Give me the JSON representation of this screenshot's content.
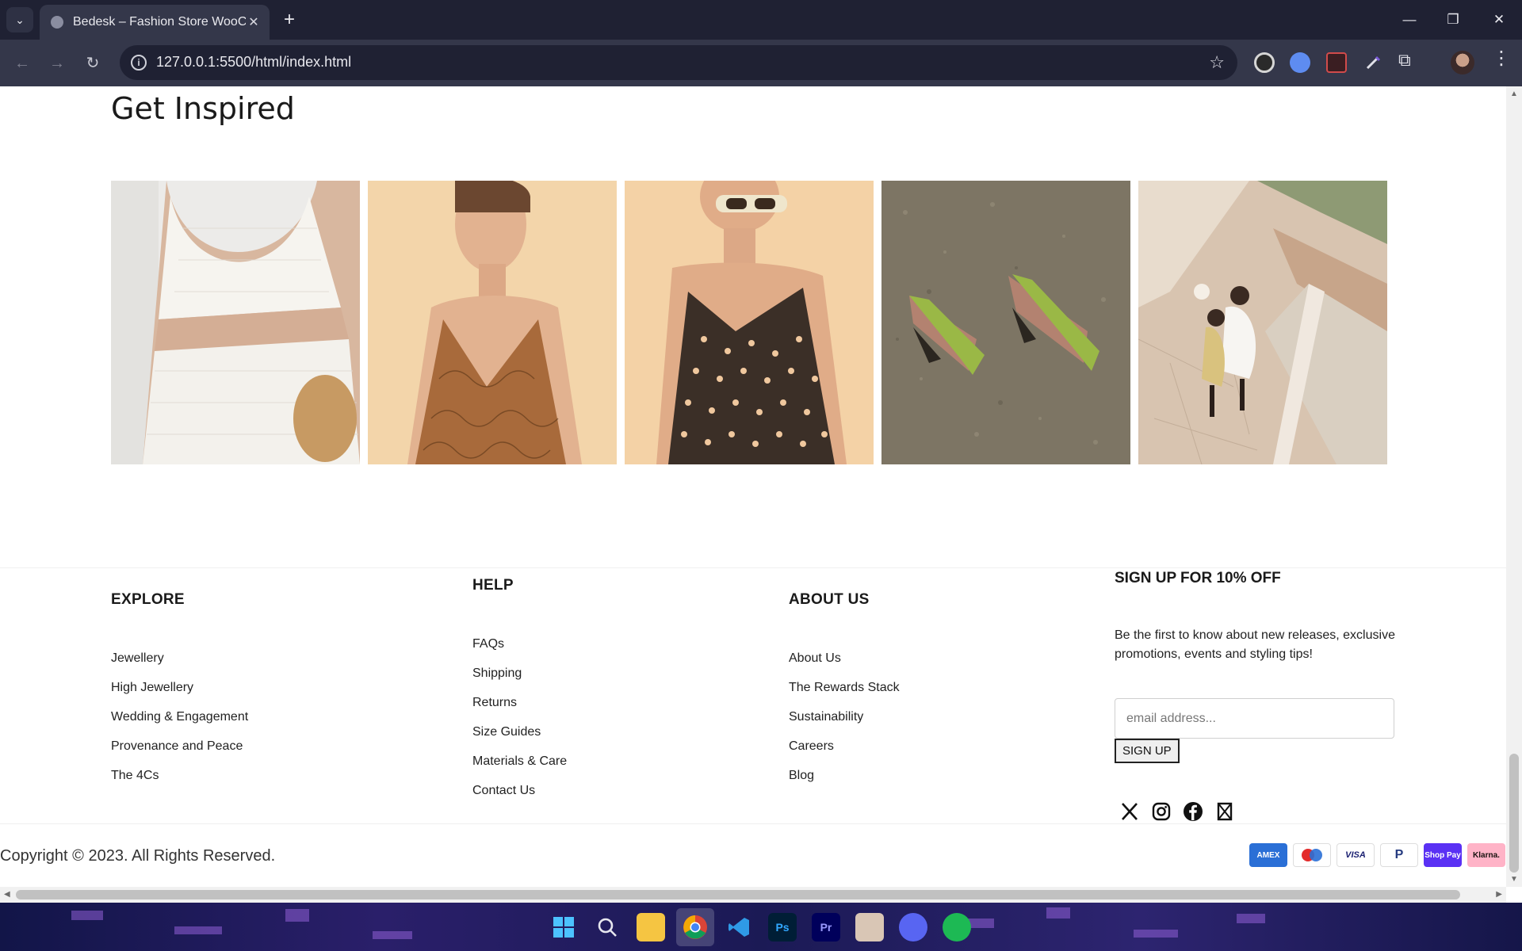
{
  "browser": {
    "tab_title": "Bedesk – Fashion Store WooCommerce",
    "url": "127.0.0.1:5500/html/index.html",
    "new_tab_label": "+",
    "controls": {
      "minimize": "—",
      "restore": "❐",
      "close": "✕"
    }
  },
  "inspire": {
    "title": "Get Inspired",
    "images": [
      {
        "name": "white-crochet-top-photo"
      },
      {
        "name": "brown-floral-dress-photo"
      },
      {
        "name": "polka-dot-dress-photo"
      },
      {
        "name": "green-sandals-photo"
      },
      {
        "name": "couple-terrace-photo"
      }
    ]
  },
  "footer": {
    "explore": {
      "title": "EXPLORE",
      "links": [
        "Jewellery",
        "High Jewellery",
        "Wedding & Engagement",
        "Provenance and Peace",
        "The 4Cs"
      ]
    },
    "help": {
      "title": "HELP",
      "links": [
        "FAQs",
        "Shipping",
        "Returns",
        "Size Guides",
        "Materials & Care",
        "Contact Us"
      ]
    },
    "about": {
      "title": "ABOUT US",
      "links": [
        "About Us",
        "The Rewards Stack",
        "Sustainability",
        "Careers",
        "Blog"
      ]
    },
    "signup": {
      "title": "SIGN UP FOR 10% OFF",
      "text": "Be the first to know about new releases, exclusive promotions, events and styling tips!",
      "placeholder": "email address...",
      "button": "SIGN UP"
    },
    "social_icons": [
      "x-icon",
      "instagram-icon",
      "facebook-icon",
      "tiktok-icon"
    ],
    "copyright": "Copyright © 2023. All Rights Reserved.",
    "payments": [
      "AMEX",
      "Maestro",
      "VISA",
      "PayPal",
      "Shop Pay",
      "Klarna."
    ]
  },
  "colors": {
    "chrome_dark": "#1f2133",
    "chrome_mid": "#34374a",
    "text": "#1a1a1a"
  }
}
